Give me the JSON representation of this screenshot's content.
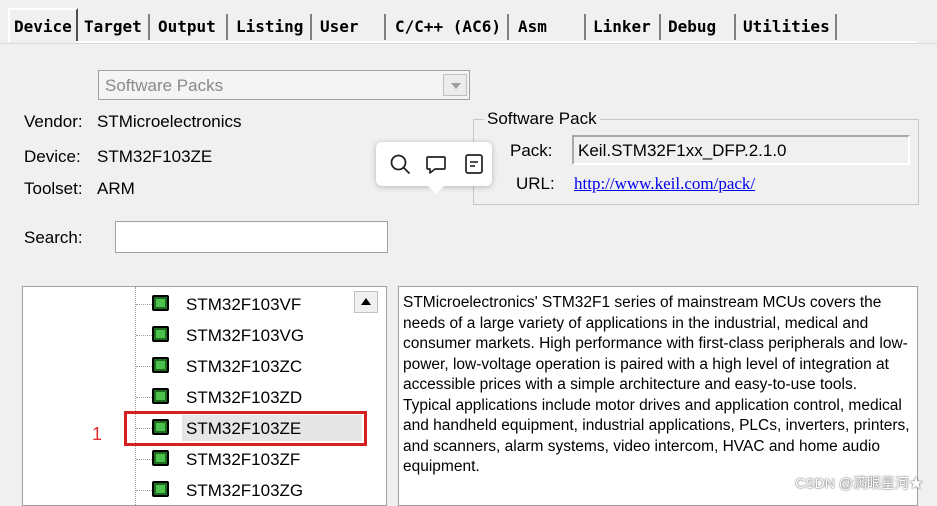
{
  "tabs": [
    {
      "label": "Device",
      "active": true
    },
    {
      "label": "Target"
    },
    {
      "label": "Output"
    },
    {
      "label": "Listing"
    },
    {
      "label": "User"
    },
    {
      "label": "C/C++ (AC6)"
    },
    {
      "label": "Asm"
    },
    {
      "label": "Linker"
    },
    {
      "label": "Debug"
    },
    {
      "label": "Utilities"
    }
  ],
  "packs_dropdown": {
    "value": "Software Packs"
  },
  "device_info": {
    "vendor_label": "Vendor:",
    "vendor": "STMicroelectronics",
    "device_label": "Device:",
    "device": "STM32F103ZE",
    "toolset_label": "Toolset:",
    "toolset": "ARM"
  },
  "software_pack": {
    "title": "Software Pack",
    "pack_label": "Pack:",
    "pack_value": "Keil.STM32F1xx_DFP.2.1.0",
    "url_label": "URL:",
    "url": "http://www.keil.com/pack/"
  },
  "popup": {
    "icons": [
      "search-icon",
      "comment-icon",
      "note-icon"
    ]
  },
  "search": {
    "label": "Search:",
    "value": ""
  },
  "device_tree": {
    "items": [
      {
        "name": "STM32F103VF"
      },
      {
        "name": "STM32F103VG"
      },
      {
        "name": "STM32F103ZC"
      },
      {
        "name": "STM32F103ZD"
      },
      {
        "name": "STM32F103ZE",
        "selected": true
      },
      {
        "name": "STM32F103ZF"
      },
      {
        "name": "STM32F103ZG"
      }
    ]
  },
  "annotation": {
    "number": "1",
    "color": "#d42020"
  },
  "description": {
    "paragraph1": "STMicroelectronics' STM32F1 series of mainstream MCUs covers the needs of a large variety of applications in the industrial, medical and consumer markets. High performance with first-class peripherals and low-power, low-voltage operation is paired with a high level of integration at accessible prices with a simple architecture and easy-to-use tools.",
    "paragraph2": "Typical applications include motor drives and application control, medical and handheld equipment, industrial applications, PLCs, inverters, printers, and scanners, alarm systems, video intercom, HVAC and home audio equipment."
  },
  "watermark": "CSDN @满眼星河★"
}
